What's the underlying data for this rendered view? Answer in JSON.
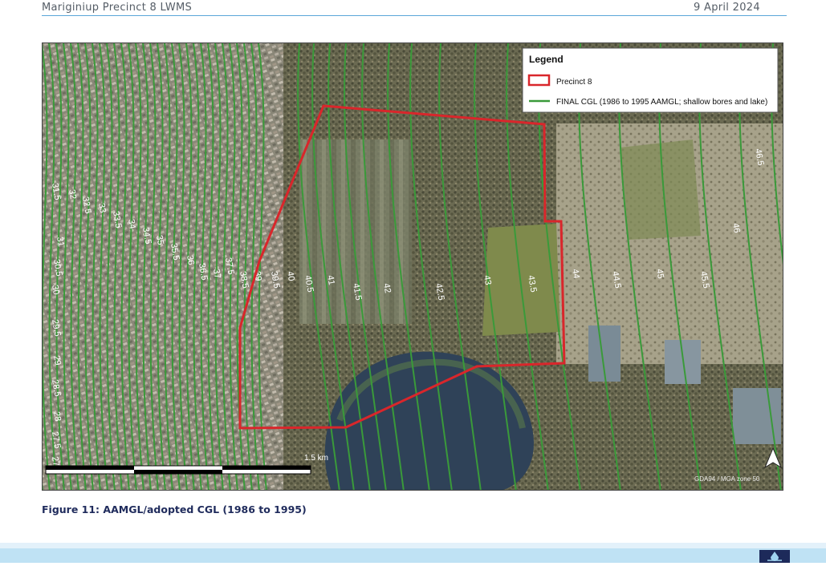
{
  "header": {
    "title": "Mariginiup Precinct 8 LWMS",
    "date": "9 April 2024"
  },
  "map": {
    "legend": {
      "title": "Legend",
      "items": [
        {
          "label": "Precinct 8",
          "color": "#d9262b",
          "symbol": "rect-outline"
        },
        {
          "label": "FINAL CGL (1986 to 1995 AAMGL; shallow bores and lake)",
          "color": "#3a9a3a",
          "symbol": "line"
        }
      ]
    },
    "contour_labels": [
      "31.5",
      "32",
      "32.5",
      "33",
      "33.5",
      "34",
      "34.5",
      "35",
      "35.5",
      "36",
      "36.5",
      "37",
      "37.5",
      "38.5",
      "39",
      "39.5",
      "40",
      "40.5",
      "41",
      "41.5",
      "42",
      "42.5",
      "43",
      "43.5",
      "44",
      "44.5",
      "45",
      "45.5",
      "46",
      "46.5",
      "31",
      "30.5",
      "30",
      "29.5",
      "29",
      "28.5",
      "28",
      "27.5",
      "27"
    ],
    "scale_bar": {
      "label": "1.5 km"
    },
    "projection": "GDA94 / MGA zone 50",
    "north_arrow_icon": "north-arrow-icon"
  },
  "caption": "Figure 11: AAMGL/adopted CGL (1986 to 1995)",
  "footer": {
    "logo_icon": "water-drop-logo-icon"
  }
}
